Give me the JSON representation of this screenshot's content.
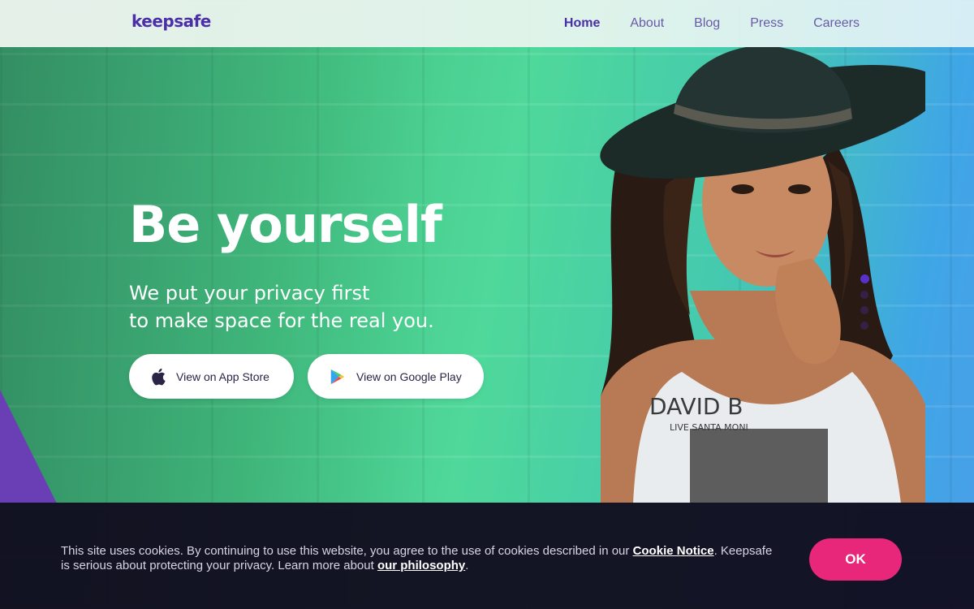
{
  "brand": {
    "logo_text": "keepsafe",
    "accent": "#4a2fa8",
    "cta_color": "#e9277a"
  },
  "nav": {
    "items": [
      {
        "label": "Home",
        "active": true
      },
      {
        "label": "About",
        "active": false
      },
      {
        "label": "Blog",
        "active": false
      },
      {
        "label": "Press",
        "active": false
      },
      {
        "label": "Careers",
        "active": false
      }
    ]
  },
  "hero": {
    "title": "Be yourself",
    "subtitle_line1": "We put your privacy first",
    "subtitle_line2": "to make space for the real you.",
    "app_store_label": "View on App Store",
    "app_store_icon": "apple-icon",
    "google_play_label": "View on Google Play",
    "google_play_icon": "google-play-icon",
    "shirt_text_line1": "DAVID B",
    "shirt_text_line2": "LIVE SANTA MONI",
    "slider_count": 4,
    "slider_active": 1
  },
  "cookie": {
    "text_before": "This site uses cookies. By continuing to use this website, you agree to the use of cookies described in our ",
    "link1": "Cookie Notice",
    "text_middle": ". Keepsafe is serious about protecting your privacy. Learn more about ",
    "link2": "our philosophy",
    "text_after": ".",
    "ok_label": "OK"
  }
}
